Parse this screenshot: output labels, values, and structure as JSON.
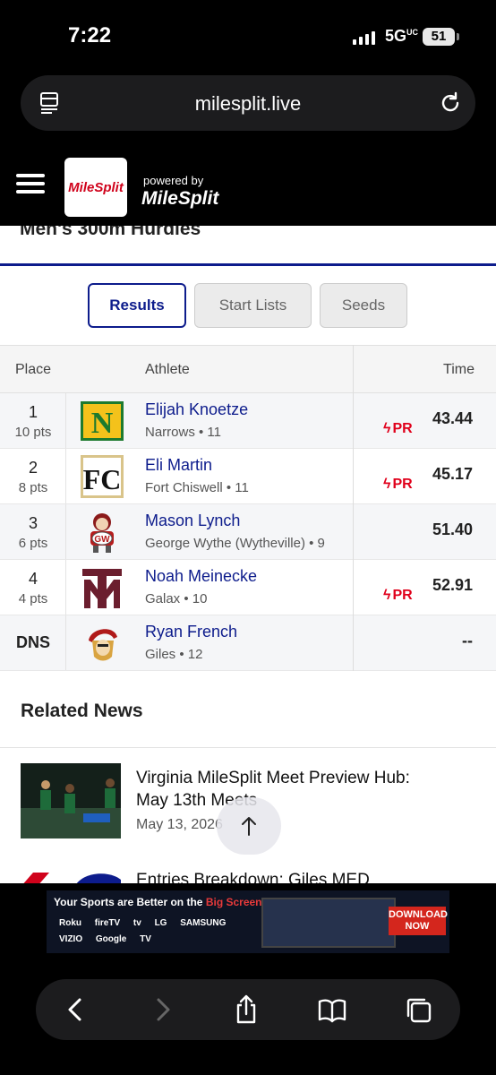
{
  "status_bar": {
    "time": "7:22",
    "network": "5G",
    "network_sup": "UC",
    "battery": "51"
  },
  "browser": {
    "url": "milesplit.live"
  },
  "header": {
    "logo_text": "MileSplit",
    "powered_by": "powered by",
    "powered_brand": "MileSplit"
  },
  "event": {
    "title": "Men's 300m Hurdles"
  },
  "tabs": [
    {
      "label": "Results",
      "active": true
    },
    {
      "label": "Start Lists",
      "active": false
    },
    {
      "label": "Seeds",
      "active": false
    }
  ],
  "table": {
    "headers": {
      "place": "Place",
      "athlete": "Athlete",
      "time": "Time"
    },
    "rows": [
      {
        "place": "1",
        "pts": "10 pts",
        "name": "Elijah Knoetze",
        "school": "Narrows • 11",
        "pr": "PR",
        "time": "43.44",
        "logo": "narrows-logo"
      },
      {
        "place": "2",
        "pts": "8 pts",
        "name": "Eli Martin",
        "school": "Fort Chiswell • 11",
        "pr": "PR",
        "time": "45.17",
        "logo": "fort-chiswell-logo"
      },
      {
        "place": "3",
        "pts": "6 pts",
        "name": "Mason Lynch",
        "school": "George Wythe (Wytheville) • 9",
        "pr": "",
        "time": "51.40",
        "logo": "george-wythe-logo"
      },
      {
        "place": "4",
        "pts": "4 pts",
        "name": "Noah Meinecke",
        "school": "Galax • 10",
        "pr": "PR",
        "time": "52.91",
        "logo": "galax-logo"
      },
      {
        "place": "DNS",
        "pts": "",
        "name": "Ryan French",
        "school": "Giles • 12",
        "pr": "",
        "time": "--",
        "logo": "giles-logo"
      }
    ]
  },
  "related": {
    "title": "Related News",
    "items": [
      {
        "title": "Virginia MileSplit Meet Preview Hub: May 13th Meets",
        "date": "May 13, 2026"
      },
      {
        "title": "Entries Breakdown: Giles MED"
      }
    ]
  },
  "ad": {
    "headline_start": "Your Sports are Better on the ",
    "headline_highlight": "Big Screen",
    "brands": "Roku fireTV  tv  LG SAMSUNG VIZIO Google TV",
    "cta": "DOWNLOAD NOW"
  },
  "colors": {
    "brand_blue": "#0d1c8c",
    "pr_red": "#e0001b",
    "milesplit_red": "#d0021b"
  }
}
